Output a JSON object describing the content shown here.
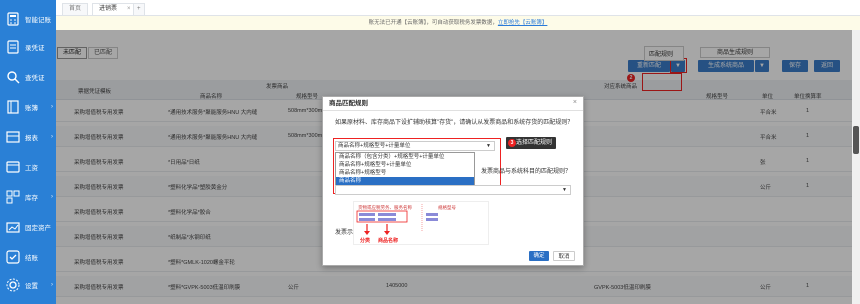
{
  "sidebar": {
    "items": [
      {
        "label": "智能记账",
        "icon": "calculator-icon",
        "arrow": ""
      },
      {
        "label": "录凭证",
        "icon": "document-icon",
        "arrow": ""
      },
      {
        "label": "查凭证",
        "icon": "search-icon",
        "arrow": ""
      },
      {
        "label": "账簿",
        "icon": "book-icon",
        "arrow": "›"
      },
      {
        "label": "报表",
        "icon": "report-icon",
        "arrow": "›"
      },
      {
        "label": "工资",
        "icon": "wallet-icon",
        "arrow": ""
      },
      {
        "label": "库存",
        "icon": "inventory-icon",
        "arrow": "›"
      },
      {
        "label": "固定资产",
        "icon": "asset-icon",
        "arrow": ""
      },
      {
        "label": "结账",
        "icon": "check-icon",
        "arrow": ""
      },
      {
        "label": "设置",
        "icon": "gear-icon",
        "arrow": "›"
      }
    ]
  },
  "tabs": [
    {
      "label": "首页"
    },
    {
      "label": "进销票",
      "close": "×"
    }
  ],
  "tab_add": "+",
  "notice": {
    "text": "账无法已开通【云账簿】，可自动获取税务发票数据，",
    "link": "立即抢先【云账簿】"
  },
  "match_tabs": {
    "unmatched": "未匹配",
    "matched": "已匹配"
  },
  "toolbar": {
    "rematch": "重新匹配",
    "rematch_caret": "▼",
    "generate": "生成系统商品",
    "generate_caret": "▼",
    "save": "保存",
    "back": "返回",
    "menu_rule": "匹配规则",
    "menu_gen": "商品生成规则"
  },
  "badges": {
    "b1": "1",
    "b2": "2",
    "b3": "3"
  },
  "table": {
    "group_headers": {
      "invoice_goods": "发票商品",
      "system_goods": "对应系统商品"
    },
    "headers": {
      "voucher_type": "票据凭证模板",
      "goods_name": "商品名称",
      "spec": "规格型号",
      "unit": "单位",
      "qty": "单位换算率",
      "spec2": "规格型号"
    },
    "rows": [
      {
        "type": "采购增值税专用发票",
        "name": "*通用技术服务*聚能服务HNU 大内缝",
        "spec": "508mm*300m",
        "unit": "平合米",
        "rate": "1"
      },
      {
        "type": "采购增值税专用发票",
        "name": "*通用技术服务*聚能服务HNU 大内缝",
        "spec": "508mm*300m",
        "unit": "平合米",
        "rate": "1"
      },
      {
        "type": "采购增值税专用发票",
        "name": "*日用品*日纸",
        "spec": "",
        "unit": "张",
        "rate": "1"
      },
      {
        "type": "采购增值税专用发票",
        "name": "*塑料化学品*塑胶黄金分",
        "spec": "",
        "unit": "公斤",
        "rate": "1"
      },
      {
        "type": "采购增值税专用发票",
        "name": "*塑料化学品*胶合",
        "spec": "",
        "unit": "",
        "rate": ""
      },
      {
        "type": "采购增值税专用发票",
        "name": "*纸制品*水钢印纸",
        "spec": "",
        "unit": "",
        "rate": ""
      },
      {
        "type": "采购增值税专用发票",
        "name": "*塑料*GMLK-1020螺金平轮",
        "spec": "",
        "unit": "",
        "rate": ""
      },
      {
        "type": "采购增值税专用发票",
        "name": "*塑料*GVPK-5003低温印刷膜",
        "spec": "公斤",
        "qty": "1405000",
        "sysspec": "GVPK-5003低温印刷膜",
        "unit": "公斤",
        "rate": "1"
      }
    ]
  },
  "modal": {
    "title": "商品匹配规则",
    "close": "×",
    "question1": "如果原材料、库存商品下设扩辅助核算\"存货\"，请确认从发票商品和系统存货的匹配规则？",
    "select_value": "商品名称+规格型号+计量单位",
    "options": [
      "商品名称（包含分类）+规格型号+计量单位",
      "商品名称+规格型号+计量单位",
      "商品名称+规格型号",
      "商品名称"
    ],
    "tooltip": "选择匹配规则",
    "question2": "发票商品与系统科目的匹配规则？",
    "example_label": "发票示例",
    "example_note_classify": "分类",
    "example_note_name": "商品名称",
    "example_header_name": "货物或应税劳务、服务名称",
    "example_header_spec": "规格型号",
    "confirm": "确定",
    "cancel": "取消"
  },
  "colors": {
    "sidebar": "#2a80d6",
    "primary": "#3b7dc9",
    "highlight": "#e22222"
  }
}
